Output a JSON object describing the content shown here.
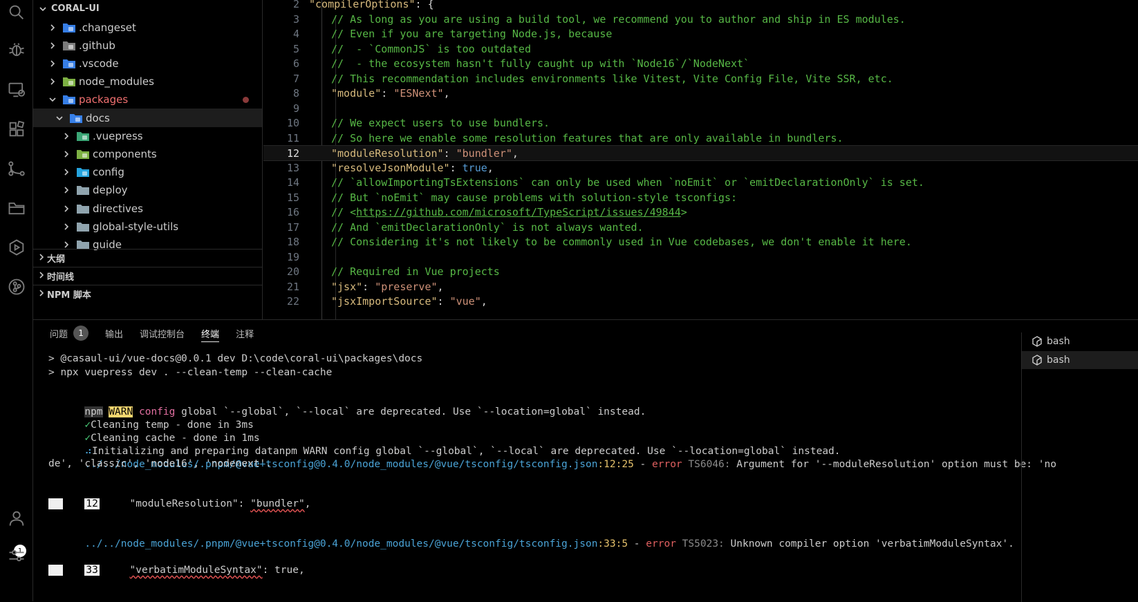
{
  "explorer": {
    "root_label": "CORAL-UI",
    "items": [
      {
        "label": ".changeset",
        "depth": 0,
        "expanded": false,
        "icon": "changeset-folder-icon",
        "color": "#3c8cff"
      },
      {
        "label": ".github",
        "depth": 0,
        "expanded": false,
        "icon": "github-folder-icon",
        "color": "#8a8a8a"
      },
      {
        "label": ".vscode",
        "depth": 0,
        "expanded": false,
        "icon": "vscode-folder-icon",
        "color": "#3c8cff"
      },
      {
        "label": "node_modules",
        "depth": 0,
        "expanded": false,
        "icon": "node-folder-icon",
        "color": "#8bc34a"
      },
      {
        "label": "packages",
        "depth": 0,
        "expanded": true,
        "icon": "packages-folder-icon",
        "color": "#3c8cff"
      },
      {
        "label": "docs",
        "depth": 1,
        "expanded": true,
        "icon": "docs-folder-icon",
        "color": "#3c8cff"
      },
      {
        "label": ".vuepress",
        "depth": 2,
        "expanded": false,
        "icon": "vuepress-folder-icon",
        "color": "#41b883"
      },
      {
        "label": "components",
        "depth": 2,
        "expanded": false,
        "icon": "components-folder-icon",
        "color": "#8bc34a"
      },
      {
        "label": "config",
        "depth": 2,
        "expanded": false,
        "icon": "config-folder-icon",
        "color": "#29b6f6"
      },
      {
        "label": "deploy",
        "depth": 2,
        "expanded": false,
        "icon": "folder-icon",
        "color": "#90a4ae"
      },
      {
        "label": "directives",
        "depth": 2,
        "expanded": false,
        "icon": "folder-icon",
        "color": "#90a4ae"
      },
      {
        "label": "global-style-utils",
        "depth": 2,
        "expanded": false,
        "icon": "folder-icon",
        "color": "#90a4ae"
      },
      {
        "label": "guide",
        "depth": 2,
        "expanded": false,
        "icon": "folder-icon",
        "color": "#90a4ae"
      }
    ],
    "sections": [
      "大纲",
      "时间线",
      "NPM 脚本"
    ]
  },
  "editor": {
    "current_line": 12,
    "lines": [
      {
        "n": "2"
      },
      {
        "n": "3",
        "text": "// As long as you are using a build tool, we recommend you to author and ship in ES modules."
      },
      {
        "n": "4",
        "text": "// Even if you are targeting Node.js, because"
      },
      {
        "n": "5",
        "text": "//  - `CommonJS` is too outdated"
      },
      {
        "n": "6",
        "text": "//  - the ecosystem hasn't fully caught up with `Node16`/`NodeNext`"
      },
      {
        "n": "7",
        "text": "// This recommendation includes environments like Vitest, Vite Config File, Vite SSR, etc."
      },
      {
        "n": "8"
      },
      {
        "n": "9",
        "text": ""
      },
      {
        "n": "10",
        "text": "// We expect users to use bundlers."
      },
      {
        "n": "11",
        "text": "// So here we enable some resolution features that are only available in bundlers."
      },
      {
        "n": "12"
      },
      {
        "n": "13"
      },
      {
        "n": "14",
        "text": "// `allowImportingTsExtensions` can only be used when `noEmit` or `emitDeclarationOnly` is set."
      },
      {
        "n": "15",
        "text": "// But `noEmit` may cause problems with solution-style tsconfigs:"
      },
      {
        "n": "16"
      },
      {
        "n": "17",
        "text": "// And `emitDeclarationOnly` is not always wanted."
      },
      {
        "n": "18",
        "text": "// Considering it's not likely to be commonly used in Vue codebases, we don't enable it here."
      },
      {
        "n": "19",
        "text": ""
      },
      {
        "n": "20",
        "text": "// Required in Vue projects"
      },
      {
        "n": "21"
      },
      {
        "n": "22"
      }
    ],
    "tokens": {
      "compiler_options_key": "\"compilerOptions\"",
      "module_key": "\"module\"",
      "module_val": "\"ESNext\"",
      "module_resolution_key": "\"moduleResolution\"",
      "module_resolution_val": "\"bundler\"",
      "resolve_json_key": "\"resolveJsonModule\"",
      "true_kw": "true",
      "link_prefix": "// <",
      "link_url": "https://github.com/microsoft/TypeScript/issues/49844",
      "link_suffix": ">",
      "jsx_key": "\"jsx\"",
      "jsx_val": "\"preserve\"",
      "jsx_import_key": "\"jsxImportSource\"",
      "jsx_import_val": "\"vue\""
    }
  },
  "panel": {
    "tabs": [
      {
        "label": "问题",
        "badge": "1"
      },
      {
        "label": "输出"
      },
      {
        "label": "调试控制台"
      },
      {
        "label": "终端",
        "active": true
      },
      {
        "label": "注释"
      }
    ],
    "terminals": [
      {
        "label": "bash"
      },
      {
        "label": "bash",
        "active": true
      }
    ],
    "terminal": {
      "l1": "> @casaul-ui/vue-docs@0.0.1 dev D:\\code\\coral-ui\\packages\\docs",
      "l2": "> npx vuepress dev . --clean-temp --clean-cache",
      "l3_npm": "npm",
      "l3_warn": "WARN",
      "l3_config": "config",
      "l3_rest": " global `--global`, `--local` are deprecated. Use `--location=global` instead.",
      "check": "✓",
      "l4": "Cleaning temp - done in 3ms",
      "l5": "Cleaning cache - done in 1ms",
      "spinner": "⠴",
      "l6": "Initializing and preparing datanpm WARN config global `--global`, `--local` are deprecated. Use `--location=global` instead.",
      "err1_path": "../../node_modules/.pnpm/@vue+tsconfig@0.4.0/node_modules/@vue/tsconfig/tsconfig.json",
      "err1_pos": ":12:25",
      "dash": " - ",
      "error_word": "error",
      "err1_code": " TS6046:",
      "err1_msg": " Argument for '--moduleResolution' option must be: 'no",
      "err1_msg2": "de', 'classic', 'node16', 'nodenext'.",
      "snip1_ln": "12",
      "snip1_key": "\"moduleResolution\"",
      "snip1_colon": ": ",
      "snip1_val": "\"bundler\"",
      "snip1_end": ",",
      "err2_path": "../../node_modules/.pnpm/@vue+tsconfig@0.4.0/node_modules/@vue/tsconfig/tsconfig.json",
      "err2_pos": ":33:5",
      "err2_code": " TS5023:",
      "err2_msg": " Unknown compiler option 'verbatimModuleSyntax'.",
      "snip2_ln": "33",
      "snip2_key": "\"verbatimModuleSyntax\"",
      "snip2_rest": ": true,"
    }
  },
  "activity": {
    "account_badge": "1"
  }
}
